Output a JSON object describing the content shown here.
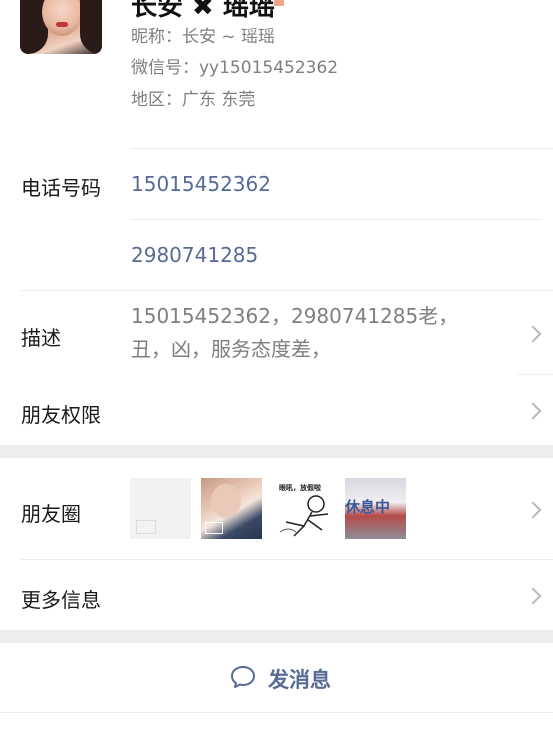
{
  "profile": {
    "display_name": "长安 ✖ 瑶瑶",
    "nickname": "昵称：长安 ~ 瑶瑶",
    "wechat_id": "微信号：yy15015452362",
    "region": "地区：广东  东莞"
  },
  "phone": {
    "label": "电话号码",
    "numbers": [
      "15015452362",
      "2980741285"
    ]
  },
  "description": {
    "label": "描述",
    "text": "15015452362，2980741285老，丑，凶，服务态度差，"
  },
  "permissions": {
    "label": "朋友权限"
  },
  "moments": {
    "label": "朋友圈",
    "thumbnails": [
      {
        "caption": ""
      },
      {
        "caption": ""
      },
      {
        "caption": "眼吼，放假啦"
      },
      {
        "caption": "休息中"
      }
    ]
  },
  "more_info": {
    "label": "更多信息"
  },
  "actions": {
    "send_message": "发消息"
  },
  "colors": {
    "link": "#576b95",
    "muted": "#7f7f7f",
    "divider": "#ededed"
  }
}
